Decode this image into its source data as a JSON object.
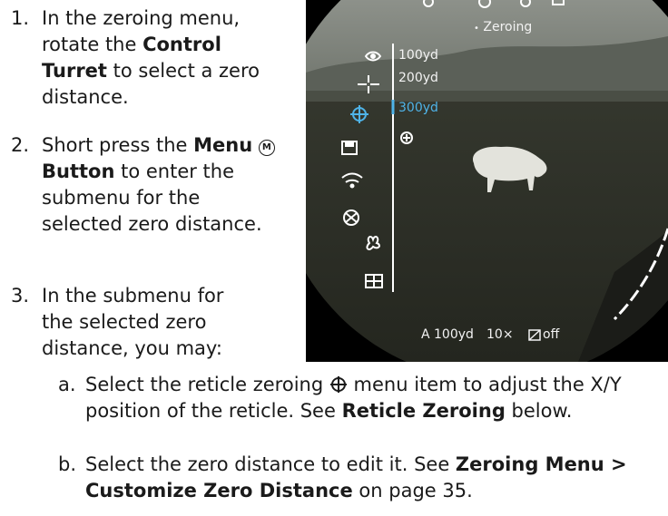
{
  "steps": [
    {
      "num": "1.",
      "pre": "In the zeroing menu, rotate the ",
      "bold": "Control Turret",
      "post": " to select a zero distance."
    },
    {
      "num": "2.",
      "pre": "Short press the ",
      "bold": "Menu",
      "icon": "M",
      "bold2": "Button",
      "post": " to enter the submenu for the selected zero distance."
    },
    {
      "num": "3.",
      "pre": "In the submenu for the selected zero distance, you may:"
    }
  ],
  "substeps": [
    {
      "num": "a.",
      "pre": "Select the reticle zeroing ",
      "icon": "reticle-zeroing-icon",
      "mid": " menu item to adjust the X/Y position of the reticle. See ",
      "bold": "Reticle Zeroing",
      "post": " below."
    },
    {
      "num": "b.",
      "pre": "Select the zero distance to edit it. See ",
      "bold": "Zeroing Menu > Customize Zero Distance",
      "post": " on page 35."
    }
  ],
  "screen": {
    "menu_title": "Zeroing",
    "distances": [
      "100yd",
      "200yd",
      "300yd"
    ],
    "selected_distance": "300yd",
    "status": {
      "mode": "A 100yd",
      "zoom": "10×",
      "pip": "off"
    },
    "accent": "#4fb3e8"
  }
}
